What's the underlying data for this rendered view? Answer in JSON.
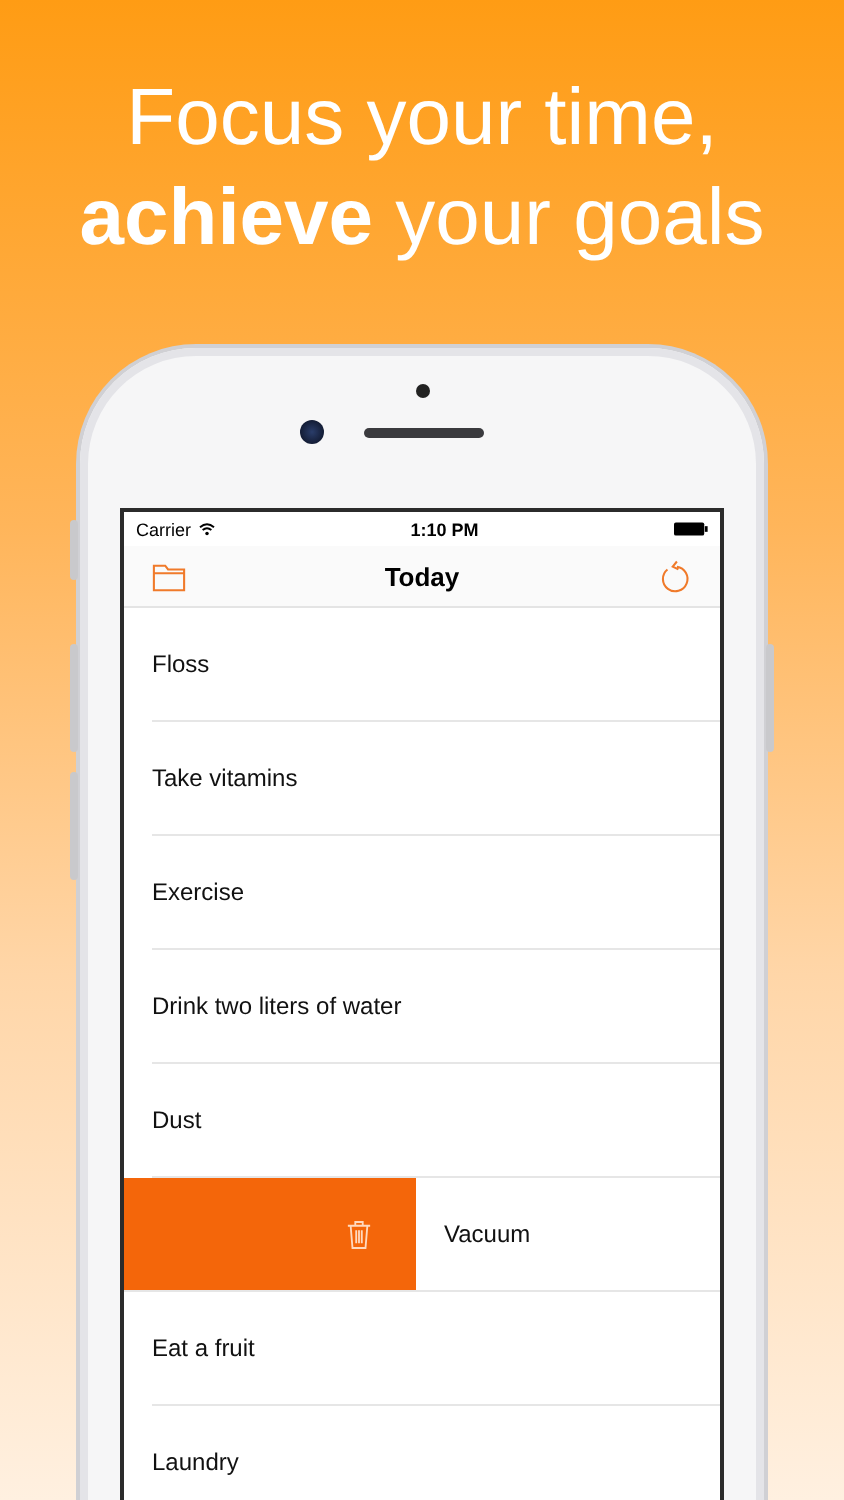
{
  "headline": [
    "Focus your time,",
    "**achieve** your goals"
  ],
  "status_bar": {
    "carrier": "Carrier",
    "time": "1:10 PM"
  },
  "nav": {
    "title": "Today"
  },
  "tasks": [
    {
      "title": "Floss",
      "kind": "normal"
    },
    {
      "title": "Take vitamins",
      "kind": "normal"
    },
    {
      "title": "Exercise",
      "kind": "normal"
    },
    {
      "title": "Drink two liters of water",
      "kind": "normal"
    },
    {
      "title": "Dust",
      "kind": "normal"
    },
    {
      "title": "Vacuum",
      "kind": "swiped"
    },
    {
      "title": "Eat a fruit",
      "kind": "normal"
    },
    {
      "title": "Laundry",
      "kind": "normal"
    }
  ]
}
